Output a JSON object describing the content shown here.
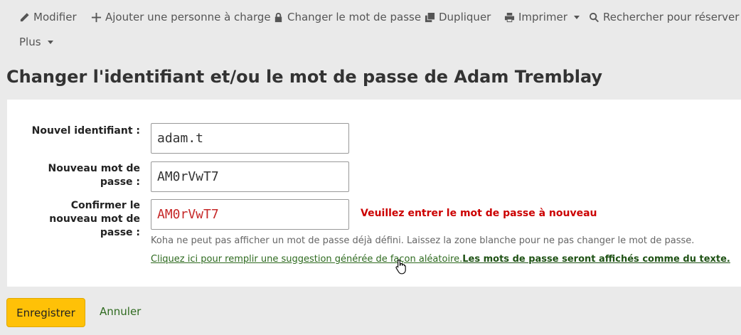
{
  "toolbar": {
    "edit": "Modifier",
    "add_dependent": "Ajouter une personne à charge",
    "change_password": "Changer le mot de passe",
    "duplicate": "Dupliquer",
    "print": "Imprimer",
    "search_to_hold": "Rechercher pour réserver",
    "more": "Plus"
  },
  "page_title": "Changer l'identifiant et/ou le mot de passe de Adam Tremblay",
  "form": {
    "userid_label": "Nouvel identifiant :",
    "userid_value": "adam.t",
    "password_label_1": "Nouveau mot de",
    "password_label_2": "passe :",
    "password_value": "AM0rVwT7",
    "confirm_label_1": "Confirmer le",
    "confirm_label_2": "nouveau mot de",
    "confirm_label_3": "passe :",
    "confirm_value": "AM0rVwT7",
    "error_message": "Veuillez entrer le mot de passe à nouveau",
    "hint": "Koha ne peut pas afficher un mot de passe déjà défini. Laissez la zone blanche pour ne pas changer le mot de passe.",
    "generate_link": "Cliquez ici pour remplir une suggestion générée de façon aléatoire.",
    "show_text_link": "Les mots de passe seront affichés comme du texte."
  },
  "actions": {
    "save": "Enregistrer",
    "cancel": "Annuler"
  },
  "colors": {
    "save_button": "#ffc107",
    "link": "#2e6a1f",
    "error": "#cc0000",
    "background": "#eaeaea"
  }
}
